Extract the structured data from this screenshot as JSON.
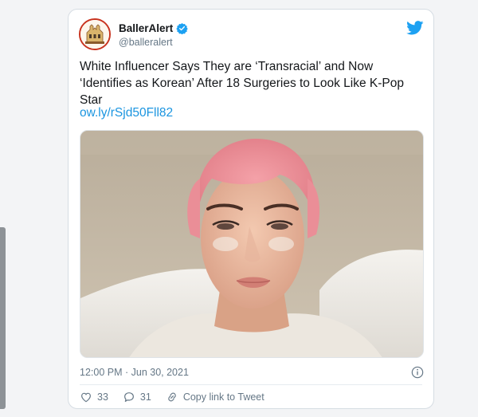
{
  "tweet": {
    "display_name": "BallerAlert",
    "handle": "@balleralert",
    "text": "White Influencer Says They are ‘Transracial’ and Now ‘Identifies as Korean’ After 18 Surgeries to Look Like K-Pop Star",
    "link": "ow.ly/rSjd50Fll82",
    "timestamp": "12:00 PM · Jun 30, 2021",
    "likes": "33",
    "replies": "31",
    "copy_link_label": "Copy link to Tweet"
  },
  "colors": {
    "twitter_blue": "#1da1f2",
    "link_blue": "#1b95e0",
    "text": "#14171a",
    "muted": "#657786"
  },
  "icons": [
    "verified-badge-icon",
    "twitter-bird-icon",
    "info-icon",
    "heart-icon",
    "reply-icon",
    "link-icon"
  ]
}
